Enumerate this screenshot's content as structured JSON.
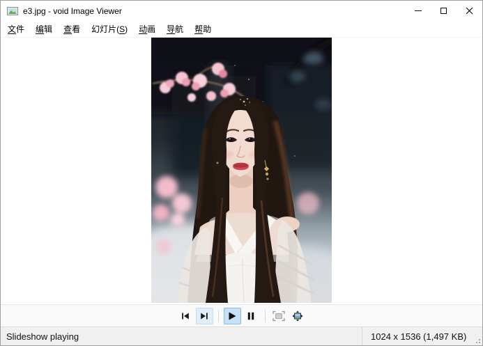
{
  "window": {
    "title": "e3.jpg - void Image Viewer",
    "controls": [
      {
        "name": "minimize"
      },
      {
        "name": "maximize"
      },
      {
        "name": "close"
      }
    ]
  },
  "menu": {
    "items": [
      {
        "pre": "",
        "hot": "文",
        "post": "件"
      },
      {
        "pre": "",
        "hot": "编",
        "post": "辑"
      },
      {
        "pre": "",
        "hot": "查",
        "post": "看"
      },
      {
        "pre": "幻灯片(",
        "hot": "S",
        "post": ")"
      },
      {
        "pre": "",
        "hot": "动",
        "post": "画"
      },
      {
        "pre": "",
        "hot": "导",
        "post": "航"
      },
      {
        "pre": "",
        "hot": "帮",
        "post": "助"
      }
    ]
  },
  "viewer": {
    "photo_description": "Portrait photo of a woman with long dark hair wearing a sheer white hanfu-style dress, pink cherry blossoms on the left, dark blurred temple background, snowy light at bottom"
  },
  "toolbar": {
    "buttons": [
      {
        "name": "previous-frame",
        "icon": "skip-previous-icon",
        "state": "normal"
      },
      {
        "name": "next-frame",
        "icon": "skip-next-icon",
        "state": "hover"
      },
      {
        "name": "play",
        "icon": "play-icon",
        "state": "active"
      },
      {
        "name": "pause",
        "icon": "pause-icon",
        "state": "normal"
      },
      {
        "name": "fit-window",
        "icon": "fit-window-icon",
        "state": "disabled"
      },
      {
        "name": "fit-image",
        "icon": "fit-image-icon",
        "state": "normal"
      }
    ]
  },
  "statusbar": {
    "left": "Slideshow playing",
    "right": "1024 x 1536 (1,497 KB)"
  },
  "colors": {
    "toolbar_active_bg": "#c6e1f7",
    "toolbar_active_border": "#8ab8e0",
    "toolbar_hover_bg": "#e0eef9",
    "toolbar_hover_border": "#c2dcf1",
    "statusbar_bg": "#f0f0f0",
    "blossom_pink": "#f5c4d0",
    "hair_dark": "#211711"
  }
}
